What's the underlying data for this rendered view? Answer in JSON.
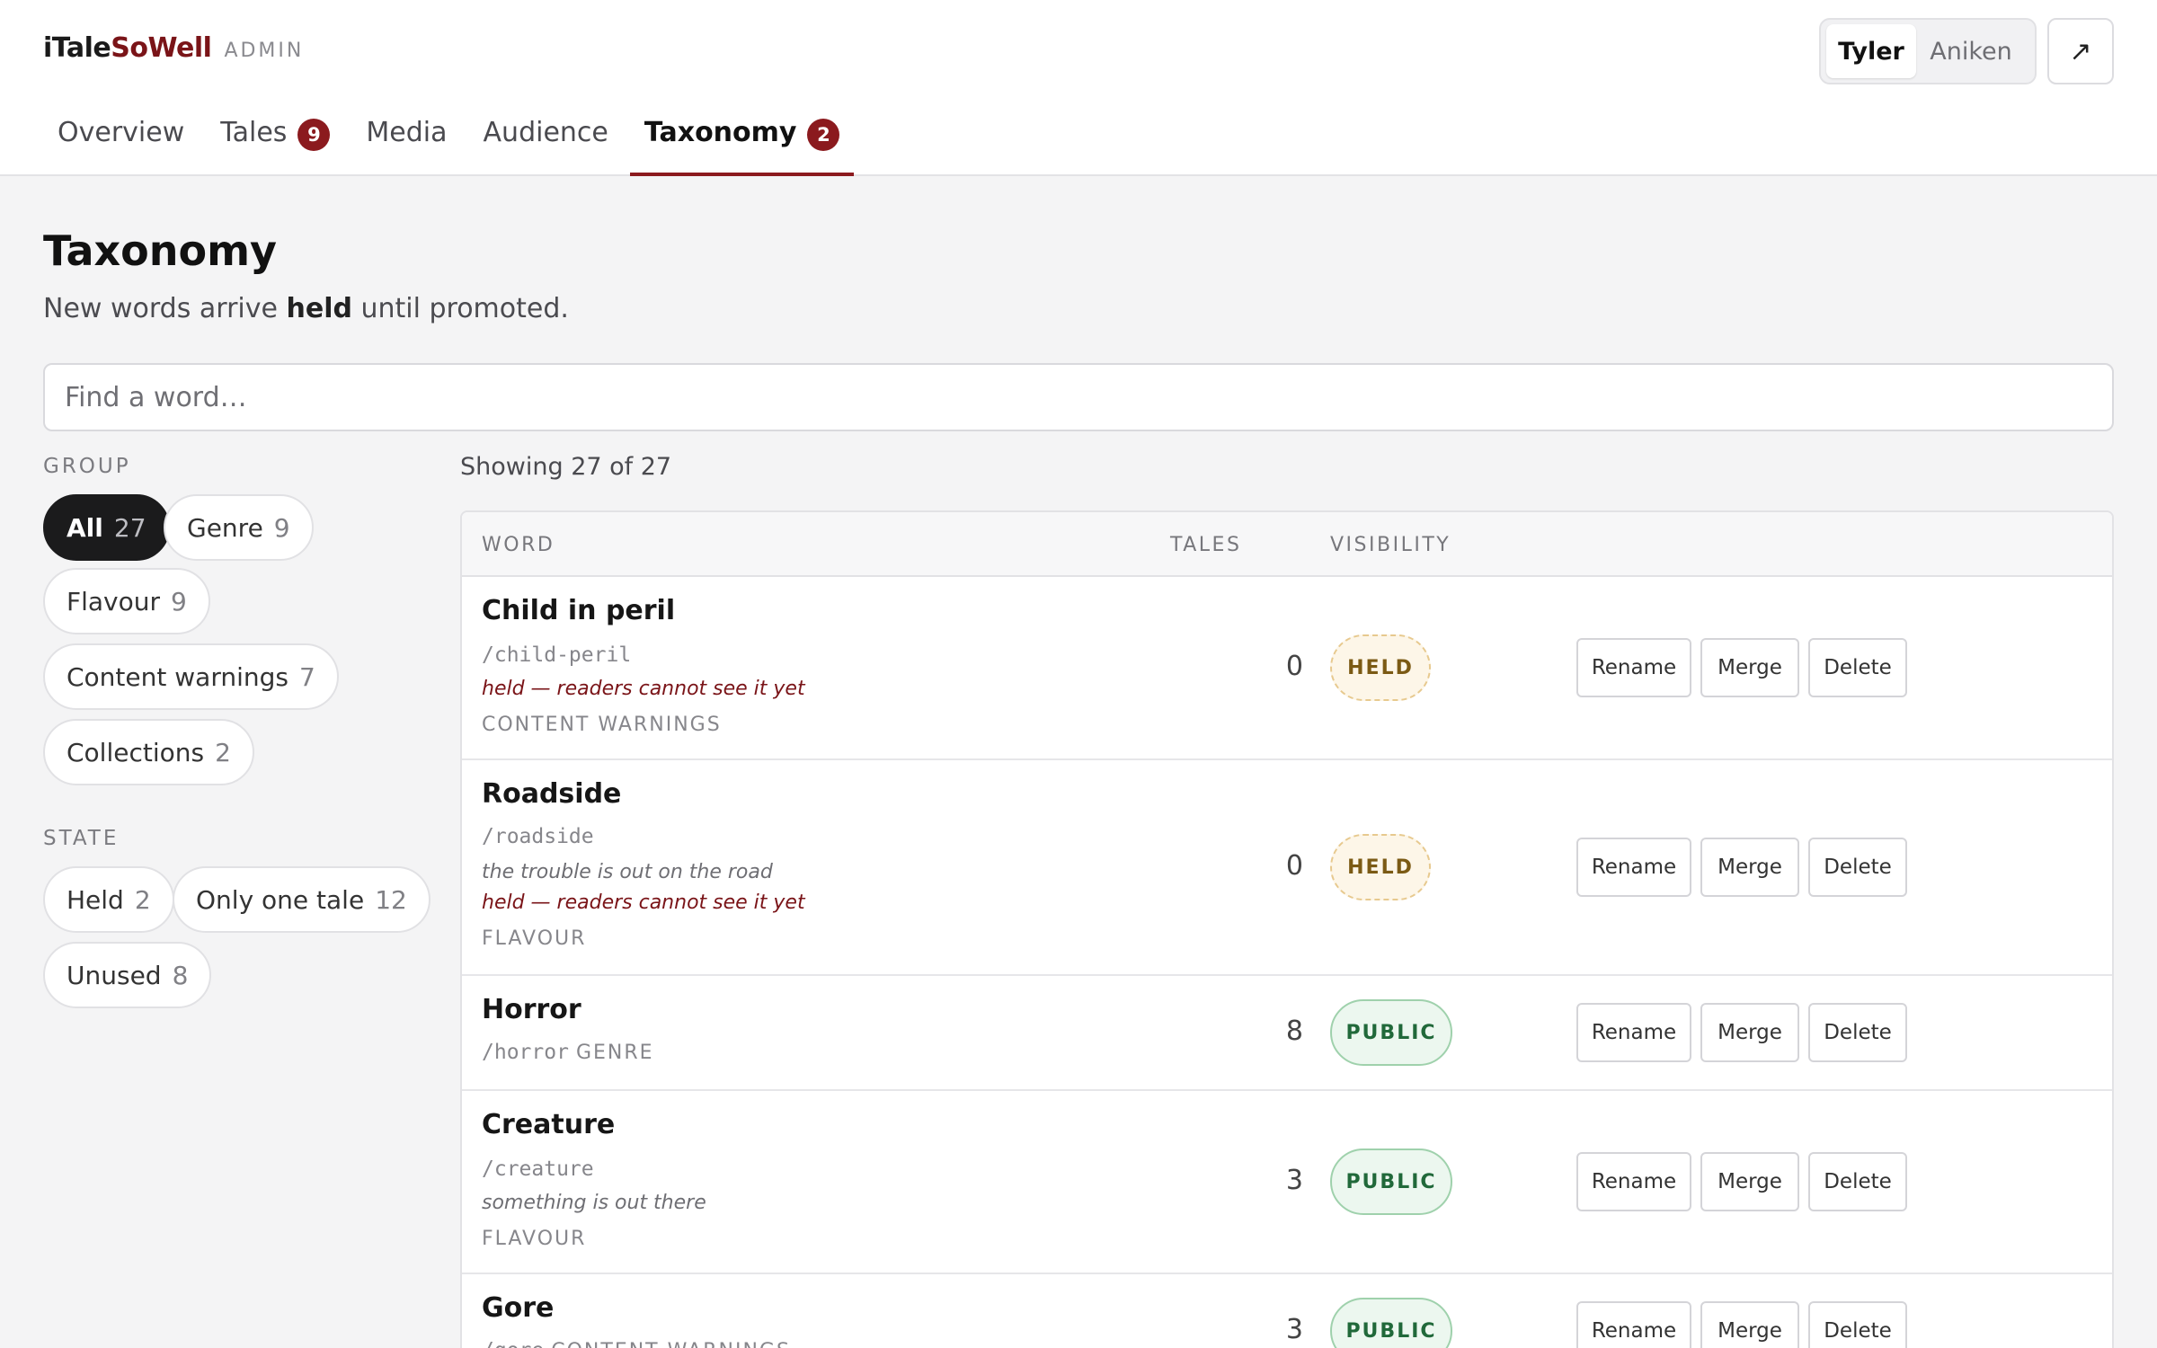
{
  "brand": {
    "prefix": "i",
    "tale": "Tale",
    "so": "So",
    "well": "Well",
    "sub": "ADMIN"
  },
  "users": {
    "active": "Tyler",
    "other": "Aniken"
  },
  "external_icon": "↗",
  "tabs": [
    {
      "label": "Overview",
      "badge": ""
    },
    {
      "label": "Tales",
      "badge": "9"
    },
    {
      "label": "Media",
      "badge": ""
    },
    {
      "label": "Audience",
      "badge": ""
    },
    {
      "label": "Taxonomy",
      "badge": "2",
      "active": true
    }
  ],
  "page": {
    "title": "Taxonomy",
    "sub_pre": "New words arrive ",
    "sub_bold": "held",
    "sub_post": " until promoted."
  },
  "search": {
    "placeholder": "Find a word…"
  },
  "filters": {
    "group_label": "GROUP",
    "groups": [
      {
        "label": "All",
        "count": "27",
        "active": true
      },
      {
        "label": "Genre",
        "count": "9"
      },
      {
        "label": "Flavour",
        "count": "9"
      },
      {
        "label": "Content warnings",
        "count": "7"
      },
      {
        "label": "Collections",
        "count": "2"
      }
    ],
    "state_label": "STATE",
    "states": [
      {
        "label": "Held",
        "count": "2"
      },
      {
        "label": "Only one tale",
        "count": "12"
      },
      {
        "label": "Unused",
        "count": "8"
      }
    ]
  },
  "table": {
    "showing": "Showing 27 of 27",
    "headers": {
      "word": "WORD",
      "tales": "TALES",
      "visibility": "VISIBILITY"
    },
    "actions": {
      "rename": "Rename",
      "merge": "Merge",
      "delete": "Delete"
    },
    "rows": [
      {
        "name": "Child in peril",
        "slug": "/child-peril",
        "desc": "",
        "held_note": "held — readers cannot see it yet",
        "group": "CONTENT WARNINGS",
        "tales": "0",
        "visibility": "HELD"
      },
      {
        "name": "Roadside",
        "slug": "/roadside",
        "desc": "the trouble is out on the road",
        "held_note": "held — readers cannot see it yet",
        "group": "FLAVOUR",
        "tales": "0",
        "visibility": "HELD"
      },
      {
        "name": "Horror",
        "slug": "/horror",
        "desc": "",
        "held_note": "",
        "group": "GENRE",
        "tales": "8",
        "visibility": "PUBLIC"
      },
      {
        "name": "Creature",
        "slug": "/creature",
        "desc": "something is out there",
        "held_note": "",
        "group": "FLAVOUR",
        "tales": "3",
        "visibility": "PUBLIC"
      },
      {
        "name": "Gore",
        "slug": "/gore",
        "desc": "",
        "held_note": "",
        "group": "CONTENT WARNINGS",
        "tales": "3",
        "visibility": "PUBLIC"
      }
    ]
  }
}
